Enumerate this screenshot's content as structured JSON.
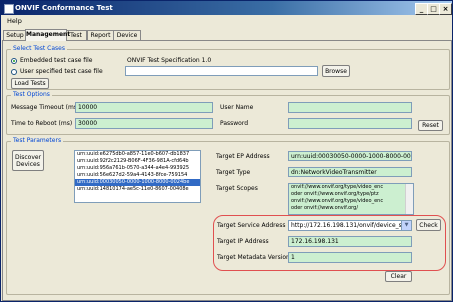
{
  "window": {
    "title": "ONVIF Conformance Test",
    "min_glyph": "_",
    "max_glyph": "□",
    "close_glyph": "×"
  },
  "menu": {
    "help": "Help"
  },
  "tabs": [
    "Setup",
    "Management",
    "Test",
    "Report",
    "Device"
  ],
  "select": {
    "legend": "Select Test Cases",
    "embedded_label": "Embedded test case file",
    "spec_name": "ONVIF Test Specification 1.0",
    "user_label": "User specified test case file",
    "user_file_value": "",
    "browse": "Browse",
    "load_tests": "Load Tests"
  },
  "options": {
    "legend": "Test Options",
    "message_timeout_label": "Message Timeout (ms)",
    "message_timeout_value": "10000",
    "time_to_reboot_label": "Time to Reboot (ms)",
    "time_to_reboot_value": "30000",
    "user_name_label": "User Name",
    "user_name_value": "",
    "password_label": "Password",
    "password_value": "",
    "reset": "Reset"
  },
  "params": {
    "legend": "Test Parameters",
    "discover": "Discover Devices",
    "devices": [
      "urn:uuid:e6275db0-a857-11e0-b607-db1837",
      "urn:uuid:92f2c2129-B06F-4F36-981A-cfd64b",
      "urn:uuid:956a761b-0570-a344-a4e4-993925",
      "urn:uuid:56e627d2-59a4-4143-8fce-759154",
      "urn:uuid:00030050-0000-1000-8000-0024be",
      "urn:uuid:14810174-ae5c-11e0-8607-00408e"
    ],
    "selected_index": 4,
    "ep_label": "Target EP Address",
    "ep_value": "urn:uuid:00030050-0000-1000-8000-0024be",
    "type_label": "Target Type",
    "type_value": "dn:NetworkVideoTransmitter",
    "scopes_label": "Target Scopes",
    "scopes_lines": [
      "onvif://www.onvif.org/type/video_enc",
      "oder onvif://www.onvif.org/type/ptz",
      "onvif://www.onvif.org/type/video_enc",
      "oder onvif://www.onvif.org/"
    ],
    "service_label": "Target Service Address",
    "service_value": "http://172.16.198.131/onvif/device_s",
    "check": "Check",
    "ip_label": "Target IP Address",
    "ip_value": "172.16.198.131",
    "metadata_label": "Target Metadata Version",
    "metadata_value": "1",
    "clear": "Clear"
  },
  "colors": {
    "field_bg": "#ccefd0",
    "highlight_border": "#e05050",
    "legend_text": "#0046d5"
  }
}
